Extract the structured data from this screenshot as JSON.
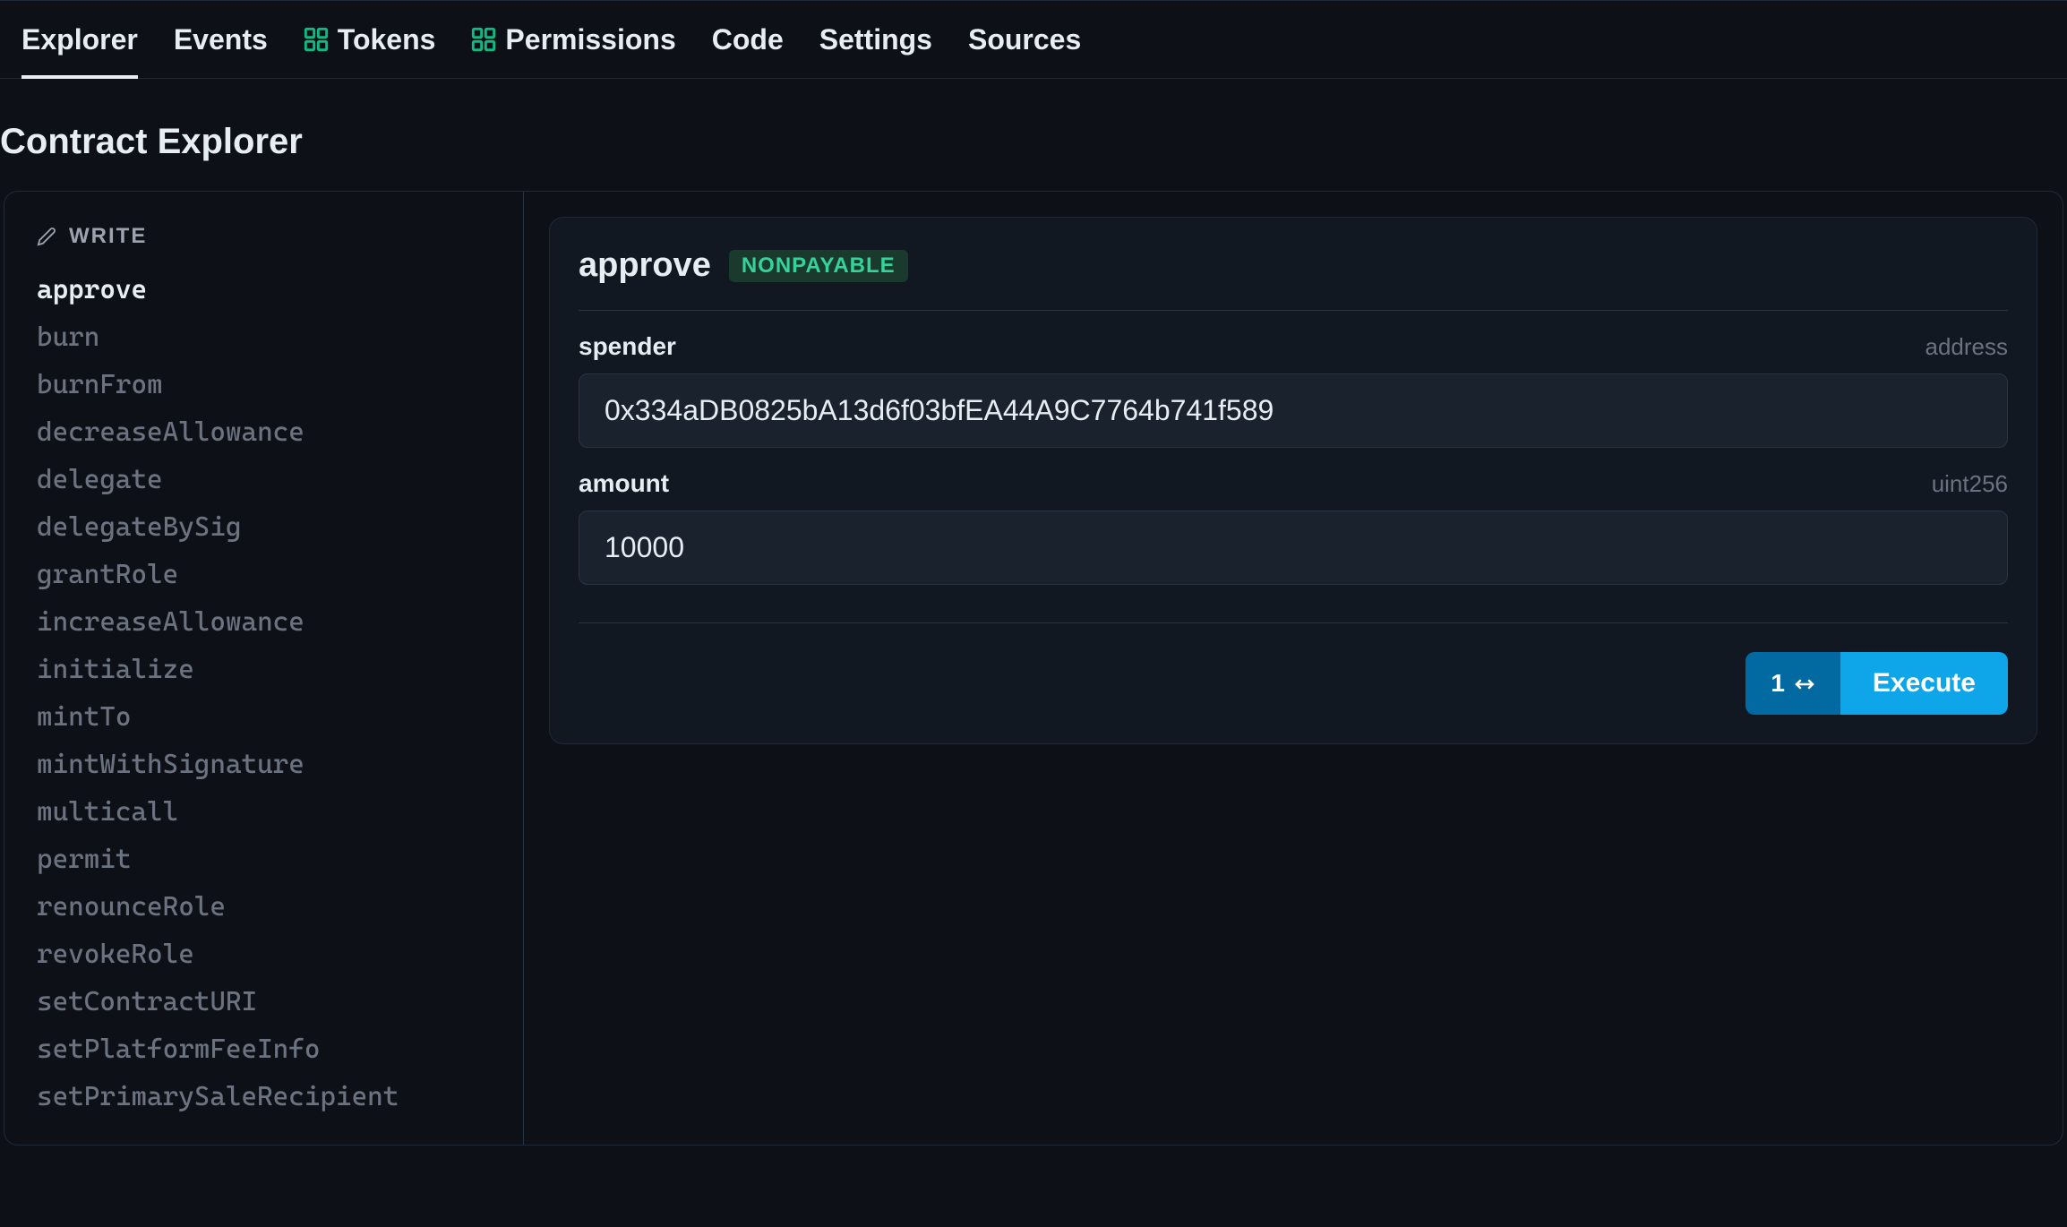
{
  "nav": {
    "tabs": [
      {
        "label": "Explorer",
        "active": true,
        "hasExtIcon": false
      },
      {
        "label": "Events",
        "active": false,
        "hasExtIcon": false
      },
      {
        "label": "Tokens",
        "active": false,
        "hasExtIcon": true
      },
      {
        "label": "Permissions",
        "active": false,
        "hasExtIcon": true
      },
      {
        "label": "Code",
        "active": false,
        "hasExtIcon": false
      },
      {
        "label": "Settings",
        "active": false,
        "hasExtIcon": false
      },
      {
        "label": "Sources",
        "active": false,
        "hasExtIcon": false
      }
    ]
  },
  "page": {
    "title": "Contract Explorer"
  },
  "sidebar": {
    "section_label": "WRITE",
    "functions": [
      {
        "name": "approve",
        "active": true
      },
      {
        "name": "burn",
        "active": false
      },
      {
        "name": "burnFrom",
        "active": false
      },
      {
        "name": "decreaseAllowance",
        "active": false
      },
      {
        "name": "delegate",
        "active": false
      },
      {
        "name": "delegateBySig",
        "active": false
      },
      {
        "name": "grantRole",
        "active": false
      },
      {
        "name": "increaseAllowance",
        "active": false
      },
      {
        "name": "initialize",
        "active": false
      },
      {
        "name": "mintTo",
        "active": false
      },
      {
        "name": "mintWithSignature",
        "active": false
      },
      {
        "name": "multicall",
        "active": false
      },
      {
        "name": "permit",
        "active": false
      },
      {
        "name": "renounceRole",
        "active": false
      },
      {
        "name": "revokeRole",
        "active": false
      },
      {
        "name": "setContractURI",
        "active": false
      },
      {
        "name": "setPlatformFeeInfo",
        "active": false
      },
      {
        "name": "setPrimarySaleRecipient",
        "active": false
      }
    ]
  },
  "function_detail": {
    "name": "approve",
    "badge_label": "NONPAYABLE",
    "params": [
      {
        "label": "spender",
        "type": "address",
        "value": "0x334aDB0825bA13d6f03bfEA44A9C7764b741f589"
      },
      {
        "label": "amount",
        "type": "uint256",
        "value": "10000"
      }
    ],
    "tx_count": "1",
    "execute_label": "Execute"
  },
  "colors": {
    "bg": "#0d1117",
    "panel_bg": "#111822",
    "input_bg": "#1a222e",
    "border": "#1f2937",
    "text_primary": "#e6edf3",
    "text_muted": "#6b7280",
    "badge_bg": "#1a3a2e",
    "badge_text": "#34d399",
    "ext_icon": "#10b981",
    "btn_primary": "#0ea5e9",
    "btn_secondary": "#0369a1"
  }
}
